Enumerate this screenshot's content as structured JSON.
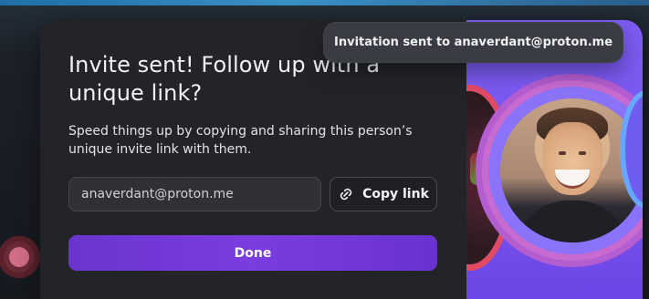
{
  "toast": {
    "message": "Invitation sent to anaverdant@proton.me"
  },
  "modal": {
    "title": "Invite sent! Follow up with a unique link?",
    "description": "Speed things up by copying and sharing this person’s unique invite link with them.",
    "email_field": {
      "value": "anaverdant@proton.me"
    },
    "copy_button": {
      "label": "Copy link",
      "icon": "link-icon"
    },
    "done_button": {
      "label": "Done"
    }
  },
  "colors": {
    "accent": "#7b3ce0",
    "art_background": "#7c5cf3",
    "modal_background": "#232428"
  }
}
